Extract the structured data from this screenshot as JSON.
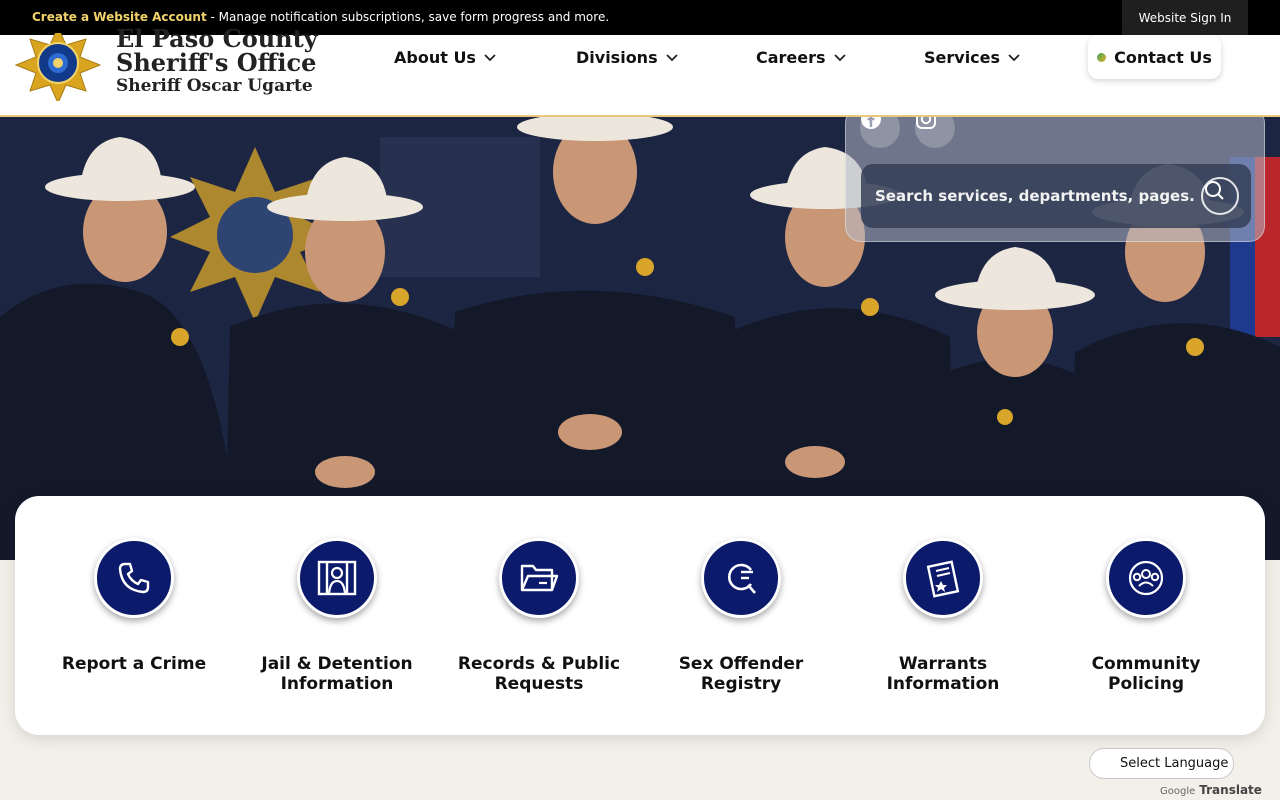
{
  "topbar": {
    "create_account_link": "Create a Website Account",
    "message": " - Manage notification subscriptions, save form progress and more.",
    "signin_label": "Website Sign In"
  },
  "logo": {
    "line1": "El Paso County",
    "line2": "Sheriff's Office",
    "line3": "Sheriff Oscar Ugarte"
  },
  "nav": {
    "items": [
      {
        "label": "About Us"
      },
      {
        "label": "Divisions"
      },
      {
        "label": "Careers"
      },
      {
        "label": "Services"
      }
    ],
    "contact_label": "Contact Us"
  },
  "hero": {
    "social": [
      "facebook-icon",
      "instagram-icon"
    ],
    "search_placeholder": "Search services, departments, pages..."
  },
  "quick_links": [
    {
      "line1": "Report a Crime",
      "line2": "",
      "icon": "phone-icon"
    },
    {
      "line1": "Jail & Detention",
      "line2": "Information",
      "icon": "jail-icon"
    },
    {
      "line1": "Records & Public",
      "line2": "Requests",
      "icon": "folder-icon"
    },
    {
      "line1": "Sex Offender",
      "line2": "Registry",
      "icon": "search-registry-icon"
    },
    {
      "line1": "Warrants",
      "line2": "Information",
      "icon": "document-icon"
    },
    {
      "line1": "Community",
      "line2": "Policing",
      "icon": "community-icon"
    }
  ],
  "translate": {
    "select_label": "Select Language",
    "google_label": "Google",
    "translate_label": "Translate"
  },
  "colors": {
    "accent_gold": "#f2d36b",
    "icon_navy": "#0b1a6b"
  }
}
